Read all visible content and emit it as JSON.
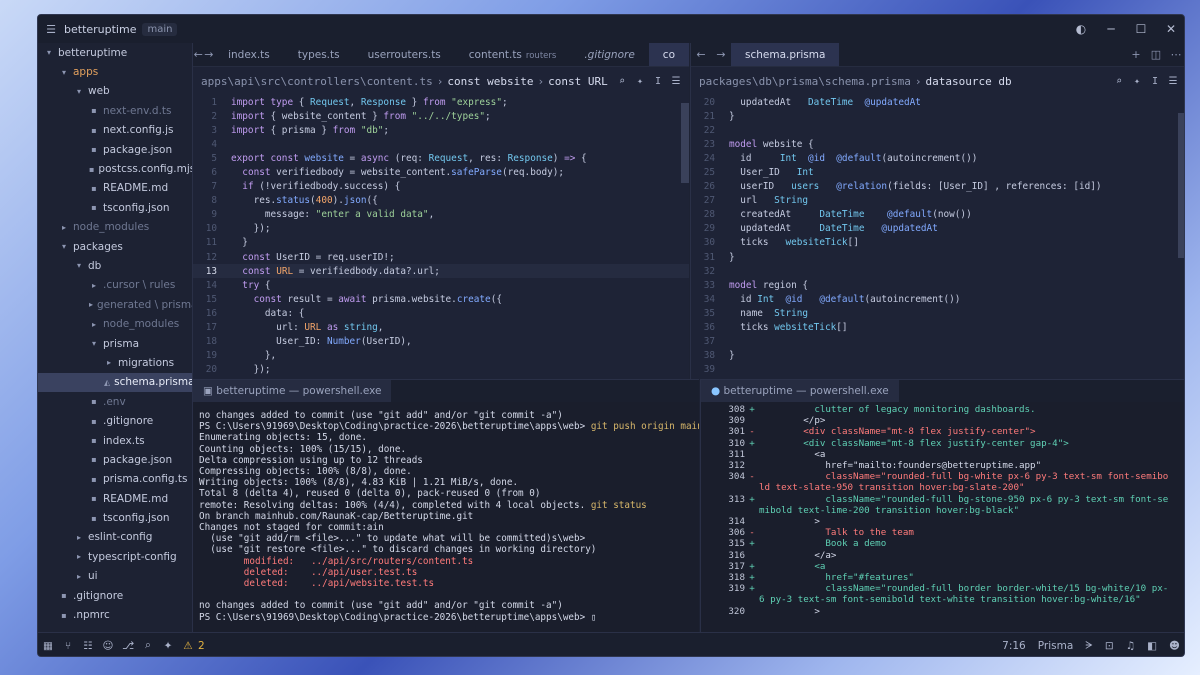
{
  "titlebar": {
    "project": "betteruptime",
    "branch": "main",
    "menu_icon": "hamburger-icon",
    "avatar_icon": "account-icon"
  },
  "sidebar": {
    "items": [
      {
        "label": "betteruptime",
        "depth": 0,
        "kind": "folder-open",
        "style": "normal"
      },
      {
        "label": "apps",
        "depth": 1,
        "kind": "folder-open",
        "style": "orange"
      },
      {
        "label": "web",
        "depth": 2,
        "kind": "folder-open",
        "style": "normal"
      },
      {
        "label": "next-env.d.ts",
        "depth": 3,
        "kind": "file",
        "style": "dim"
      },
      {
        "label": "next.config.js",
        "depth": 3,
        "kind": "file",
        "style": "normal"
      },
      {
        "label": "package.json",
        "depth": 3,
        "kind": "file",
        "style": "normal"
      },
      {
        "label": "postcss.config.mjs",
        "depth": 3,
        "kind": "file",
        "style": "normal"
      },
      {
        "label": "README.md",
        "depth": 3,
        "kind": "file",
        "style": "normal"
      },
      {
        "label": "tsconfig.json",
        "depth": 3,
        "kind": "file",
        "style": "normal"
      },
      {
        "label": "node_modules",
        "depth": 1,
        "kind": "folder",
        "style": "dim"
      },
      {
        "label": "packages",
        "depth": 1,
        "kind": "folder-open",
        "style": "normal"
      },
      {
        "label": "db",
        "depth": 2,
        "kind": "folder-open",
        "style": "normal"
      },
      {
        "label": ".cursor \\ rules",
        "depth": 3,
        "kind": "folder",
        "style": "dim"
      },
      {
        "label": "generated \\ prisma",
        "depth": 3,
        "kind": "folder",
        "style": "dim"
      },
      {
        "label": "node_modules",
        "depth": 3,
        "kind": "folder",
        "style": "dim"
      },
      {
        "label": "prisma",
        "depth": 3,
        "kind": "folder-open",
        "style": "normal"
      },
      {
        "label": "migrations",
        "depth": 4,
        "kind": "folder",
        "style": "normal"
      },
      {
        "label": "schema.prisma",
        "depth": 4,
        "kind": "prisma",
        "style": "selected"
      },
      {
        "label": ".env",
        "depth": 3,
        "kind": "file",
        "style": "dim"
      },
      {
        "label": ".gitignore",
        "depth": 3,
        "kind": "file",
        "style": "normal"
      },
      {
        "label": "index.ts",
        "depth": 3,
        "kind": "file",
        "style": "normal"
      },
      {
        "label": "package.json",
        "depth": 3,
        "kind": "file",
        "style": "normal"
      },
      {
        "label": "prisma.config.ts",
        "depth": 3,
        "kind": "file",
        "style": "normal"
      },
      {
        "label": "README.md",
        "depth": 3,
        "kind": "file",
        "style": "normal"
      },
      {
        "label": "tsconfig.json",
        "depth": 3,
        "kind": "file",
        "style": "normal"
      },
      {
        "label": "eslint-config",
        "depth": 2,
        "kind": "folder",
        "style": "normal"
      },
      {
        "label": "typescript-config",
        "depth": 2,
        "kind": "folder",
        "style": "normal"
      },
      {
        "label": "ui",
        "depth": 2,
        "kind": "folder",
        "style": "normal"
      },
      {
        "label": ".gitignore",
        "depth": 1,
        "kind": "file",
        "style": "normal"
      },
      {
        "label": ".npmrc",
        "depth": 1,
        "kind": "file",
        "style": "normal"
      }
    ]
  },
  "editor_left": {
    "tabs": [
      {
        "label": "index.ts",
        "sub": "",
        "active": false,
        "italic": false
      },
      {
        "label": "types.ts",
        "sub": "",
        "active": false,
        "italic": false
      },
      {
        "label": "userrouters.ts",
        "sub": "",
        "active": false,
        "italic": false
      },
      {
        "label": "content.ts",
        "sub": "routers",
        "active": false,
        "italic": false
      },
      {
        "label": ".gitignore",
        "sub": "",
        "active": false,
        "italic": true
      },
      {
        "label": "co",
        "sub": "",
        "active": true,
        "italic": false
      }
    ],
    "breadcrumb": {
      "path": "apps\\api\\src\\controllers\\content.ts",
      "sep": "›",
      "sym1": "const website",
      "sym2": "const URL"
    },
    "current_line": 13,
    "lines": [
      {
        "no": "1",
        "html": "<span class='k'>import type</span> { <span class='t'>Request</span>, <span class='t'>Response</span> } <span class='k'>from</span> <span class='s'>\"express\"</span>;"
      },
      {
        "no": "2",
        "html": "<span class='k'>import</span> { website_content } <span class='k'>from</span> <span class='s'>\"../../types\"</span>;"
      },
      {
        "no": "3",
        "html": "<span class='k'>import</span> { prisma } <span class='k'>from</span> <span class='s'>\"db\"</span>;"
      },
      {
        "no": "4",
        "html": ""
      },
      {
        "no": "5",
        "html": "<span class='k'>export const</span> <span class='f'>website</span> = <span class='k'>async</span> (req: <span class='t'>Request</span>, res: <span class='t'>Response</span>) <span class='k'>=&gt;</span> {"
      },
      {
        "no": "6",
        "html": "  <span class='k'>const</span> verifiedbody = website_content.<span class='f'>safeParse</span>(req.body);"
      },
      {
        "no": "7",
        "html": "  <span class='k'>if</span> (!verifiedbody.success) {"
      },
      {
        "no": "8",
        "html": "    res.<span class='f'>status</span>(<span class='n'>400</span>).<span class='f'>json</span>({"
      },
      {
        "no": "9",
        "html": "      message: <span class='s'>\"enter a valid data\"</span>,"
      },
      {
        "no": "10",
        "html": "    });"
      },
      {
        "no": "11",
        "html": "  }"
      },
      {
        "no": "12",
        "html": "  <span class='k'>const</span> UserID = req.userID!;"
      },
      {
        "no": "13",
        "html": "  <span class='k'>const</span> <span class='n'>URL</span> = verifiedbody.data?.url;"
      },
      {
        "no": "14",
        "html": "  <span class='k'>try</span> {"
      },
      {
        "no": "15",
        "html": "    <span class='k'>const</span> result = <span class='k'>await</span> prisma.website.<span class='f'>create</span>({"
      },
      {
        "no": "16",
        "html": "      data: {"
      },
      {
        "no": "17",
        "html": "        url: <span class='n'>URL</span> <span class='k'>as</span> <span class='t'>string</span>,"
      },
      {
        "no": "18",
        "html": "        User_ID: <span class='f'>Number</span>(UserID),"
      },
      {
        "no": "19",
        "html": "      },"
      },
      {
        "no": "20",
        "html": "    });"
      }
    ]
  },
  "editor_right": {
    "tabs": [
      {
        "label": "schema.prisma",
        "sub": "",
        "active": true,
        "italic": false
      }
    ],
    "breadcrumb": {
      "path": "packages\\db\\prisma\\schema.prisma",
      "sep": "›",
      "sym1": "datasource db",
      "sym2": ""
    },
    "lines": [
      {
        "no": "20",
        "html": "  updatedAt   <span class='t'>DateTime</span>  <span class='f'>@updatedAt</span>"
      },
      {
        "no": "21",
        "html": "}"
      },
      {
        "no": "22",
        "html": ""
      },
      {
        "no": "23",
        "html": "<span class='k'>model</span> website {"
      },
      {
        "no": "24",
        "html": "  id     <span class='t'>Int</span>  <span class='f'>@id</span>  <span class='f'>@default</span>(autoincrement())"
      },
      {
        "no": "25",
        "html": "  User_ID   <span class='t'>Int</span>"
      },
      {
        "no": "26",
        "html": "  userID   <span class='t'>users</span>   <span class='f'>@relation</span>(fields: [User_ID] , references: [id])"
      },
      {
        "no": "27",
        "html": "  url   <span class='t'>String</span>"
      },
      {
        "no": "28",
        "html": "  createdAt     <span class='t'>DateTime</span>    <span class='f'>@default</span>(now())"
      },
      {
        "no": "29",
        "html": "  updatedAt     <span class='t'>DateTime</span>   <span class='f'>@updatedAt</span>"
      },
      {
        "no": "30",
        "html": "  ticks   <span class='t'>websiteTick</span>[]"
      },
      {
        "no": "31",
        "html": "}"
      },
      {
        "no": "32",
        "html": ""
      },
      {
        "no": "33",
        "html": "<span class='k'>model</span> region {"
      },
      {
        "no": "34",
        "html": "  id <span class='t'>Int</span>  <span class='f'>@id</span>   <span class='f'>@default</span>(autoincrement())"
      },
      {
        "no": "35",
        "html": "  name  <span class='t'>String</span>"
      },
      {
        "no": "36",
        "html": "  ticks <span class='t'>websiteTick</span>[]"
      },
      {
        "no": "37",
        "html": ""
      },
      {
        "no": "38",
        "html": "}"
      },
      {
        "no": "39",
        "html": ""
      }
    ]
  },
  "terminal_left": {
    "tab": "betteruptime — powershell.exe",
    "lines": [
      {
        "cls": "",
        "text": "no changes added to commit (use \"git add\" and/or \"git commit -a\")"
      },
      {
        "cls": "",
        "text": "PS C:\\Users\\91969\\Desktop\\Coding\\practice-2026\\betteruptime\\apps\\web> ",
        "cmd": "git push origin main"
      },
      {
        "cls": "",
        "text": "Enumerating objects: 15, done."
      },
      {
        "cls": "",
        "text": "Counting objects: 100% (15/15), done."
      },
      {
        "cls": "",
        "text": "Delta compression using up to 12 threads"
      },
      {
        "cls": "",
        "text": "Compressing objects: 100% (8/8), done."
      },
      {
        "cls": "",
        "text": "Writing objects: 100% (8/8), 4.83 KiB | 1.21 MiB/s, done."
      },
      {
        "cls": "",
        "text": "Total 8 (delta 4), reused 0 (delta 0), pack-reused 0 (from 0)"
      },
      {
        "cls": "",
        "text": "remote: Resolving deltas: 100% (4/4), completed with 4 local objects. ",
        "cmd": "git status"
      },
      {
        "cls": "",
        "text": "On branch mainhub.com/RaunaK-cap/Betteruptime.git"
      },
      {
        "cls": "",
        "text": "Changes not staged for commit:ain"
      },
      {
        "cls": "",
        "text": "  (use \"git add/rm <file>...\" to update what will be committed)s\\web>"
      },
      {
        "cls": "",
        "text": "  (use \"git restore <file>...\" to discard changes in working directory)"
      },
      {
        "cls": "g",
        "text": "        modified:   ../api/src/routers/content.ts"
      },
      {
        "cls": "g",
        "text": "        deleted:    ../api/user.test.ts"
      },
      {
        "cls": "g",
        "text": "        deleted:    ../api/website.test.ts"
      },
      {
        "cls": "",
        "text": ""
      },
      {
        "cls": "",
        "text": "no changes added to commit (use \"git add\" and/or \"git commit -a\")"
      },
      {
        "cls": "",
        "text": "PS C:\\Users\\91969\\Desktop\\Coding\\practice-2026\\betteruptime\\apps\\web> "
      }
    ]
  },
  "terminal_right": {
    "tab": "betteruptime — powershell.exe",
    "lines": [
      {
        "no": "308",
        "m": "+",
        "cls": "add",
        "text": "          clutter of legacy monitoring dashboards."
      },
      {
        "no": "309",
        "m": "",
        "cls": "ctx",
        "text": "        </p>"
      },
      {
        "no": "301",
        "m": "-",
        "cls": "del",
        "text": "        <div className=\"mt-8 flex justify-center\">"
      },
      {
        "no": "310",
        "m": "+",
        "cls": "add",
        "text": "        <div className=\"mt-8 flex justify-center gap-4\">"
      },
      {
        "no": "311",
        "m": "",
        "cls": "ctx",
        "text": "          <a"
      },
      {
        "no": "312",
        "m": "",
        "cls": "ctx",
        "text": "            href=\"mailto:founders@betteruptime.app\""
      },
      {
        "no": "304",
        "m": "-",
        "cls": "del",
        "text": "            className=\"rounded-full bg-white px-6 py-3 text-sm font-semibold text-slate-950 transition hover:bg-slate-200\""
      },
      {
        "no": "313",
        "m": "+",
        "cls": "add",
        "text": "            className=\"rounded-full bg-stone-950 px-6 py-3 text-sm font-semibold text-lime-200 transition hover:bg-black\""
      },
      {
        "no": "314",
        "m": "",
        "cls": "ctx",
        "text": "          >"
      },
      {
        "no": "306",
        "m": "-",
        "cls": "del",
        "text": "            Talk to the team"
      },
      {
        "no": "315",
        "m": "+",
        "cls": "add",
        "text": "            Book a demo"
      },
      {
        "no": "316",
        "m": "",
        "cls": "ctx",
        "text": "          </a>"
      },
      {
        "no": "317",
        "m": "+",
        "cls": "add",
        "text": "          <a"
      },
      {
        "no": "318",
        "m": "+",
        "cls": "add",
        "text": "            href=\"#features\""
      },
      {
        "no": "319",
        "m": "+",
        "cls": "add",
        "text": "            className=\"rounded-full border border-white/15 bg-white/10 px-6 py-3 text-sm font-semibold text-white transition hover:bg-white/16\""
      },
      {
        "no": "320",
        "m": "",
        "cls": "ctx",
        "text": "          >"
      }
    ]
  },
  "status": {
    "warnings": "2",
    "cursor": "7:16",
    "language": "Prisma"
  }
}
